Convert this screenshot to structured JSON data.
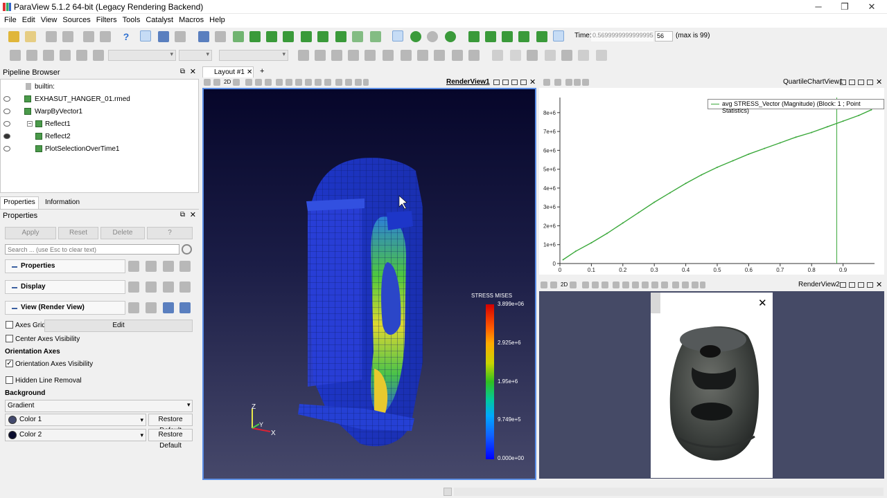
{
  "window": {
    "title": "ParaView 5.1.2 64-bit (Legacy Rendering Backend)",
    "minimize": "─",
    "maximize": "❐",
    "close": "✕"
  },
  "menu": [
    "File",
    "Edit",
    "View",
    "Sources",
    "Filters",
    "Tools",
    "Catalyst",
    "Macros",
    "Help"
  ],
  "time": {
    "label": "Time:",
    "value": "0.5699999999999995",
    "step": "56",
    "max_text": "(max is 99)"
  },
  "pipeline": {
    "title": "Pipeline Browser",
    "items": [
      {
        "label": "builtin:"
      },
      {
        "label": "EXHASUT_HANGER_01.rmed"
      },
      {
        "label": "WarpByVector1"
      },
      {
        "label": "Reflect1"
      },
      {
        "label": "Reflect2"
      },
      {
        "label": "PlotSelectionOverTime1"
      }
    ]
  },
  "tabs": {
    "properties": "Properties",
    "information": "Information"
  },
  "properties": {
    "title": "Properties",
    "apply": "Apply",
    "reset": "Reset",
    "delete": "Delete",
    "help": "?",
    "search_placeholder": "Search ... (use Esc to clear text)",
    "sections": [
      "Properties",
      "Display",
      "View (Render View)"
    ],
    "axes_grid": "Axes Grid",
    "edit": "Edit",
    "center_axes": "Center Axes Visibility",
    "orientation_axes_header": "Orientation Axes",
    "orientation_axes_visibility": "Orientation Axes Visibility",
    "hidden_line": "Hidden Line Removal",
    "background_header": "Background",
    "background_value": "Gradient",
    "color1": "Color 1",
    "color2": "Color 2",
    "restore": "Restore Default",
    "color1_swatch": "#434a6e",
    "color2_swatch": "#0a0c2e"
  },
  "layout": {
    "tab": "Layout #1",
    "add": "+"
  },
  "render_view1": {
    "name": "RenderView1",
    "mode": "2D",
    "colorbar_title": "STRESS MISES",
    "colorbar_labels": [
      "3.899e+06",
      "2.925e+6",
      "1.95e+6",
      "9.749e+5",
      "0.000e+00"
    ],
    "axes": {
      "z": "Z",
      "y": "Y",
      "x": "X"
    }
  },
  "chart_view": {
    "name": "QuartileChartView1"
  },
  "chart_data": {
    "type": "line",
    "title": "",
    "legend": "avg STRESS_Vector (Magnitude) (Block: 1 ; Point Statistics)",
    "x": [
      0.01,
      0.05,
      0.1,
      0.15,
      0.2,
      0.25,
      0.3,
      0.35,
      0.4,
      0.45,
      0.5,
      0.55,
      0.6,
      0.65,
      0.7,
      0.75,
      0.8,
      0.85,
      0.9,
      0.95,
      0.99
    ],
    "y": [
      200000.0,
      650000.0,
      1100000.0,
      1600000.0,
      2150000.0,
      2700000.0,
      3250000.0,
      3750000.0,
      4250000.0,
      4700000.0,
      5100000.0,
      5450000.0,
      5800000.0,
      6100000.0,
      6400000.0,
      6700000.0,
      6950000.0,
      7250000.0,
      7550000.0,
      7850000.0,
      8150000.0
    ],
    "xlim": [
      0,
      1
    ],
    "ylim": [
      0,
      8800000.0
    ],
    "xticks": [
      "0",
      "0.1",
      "0.2",
      "0.3",
      "0.4",
      "0.5",
      "0.6",
      "0.7",
      "0.8",
      "0.9"
    ],
    "yticks": [
      "0",
      "1e+6",
      "2e+6",
      "3e+6",
      "4e+6",
      "5e+6",
      "6e+6",
      "7e+6",
      "8e+6"
    ],
    "current_time": 0.88,
    "line_color": "#3aa83a",
    "grid": false,
    "legend_position": "top-right"
  },
  "render_view2": {
    "name": "RenderView2",
    "popup_close": "✕"
  },
  "status": {
    "text": ""
  }
}
